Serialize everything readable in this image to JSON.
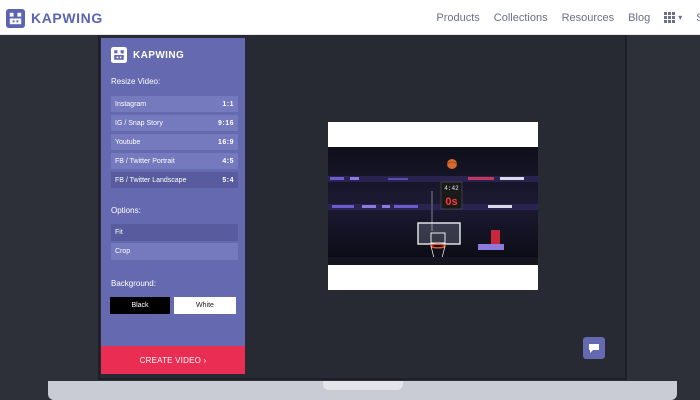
{
  "brand": {
    "name": "KAPWING"
  },
  "nav": {
    "links": [
      "Products",
      "Collections",
      "Resources",
      "Blog"
    ],
    "cutoff": "Si"
  },
  "editor": {
    "brand": "KAPWING",
    "resize_heading": "Resize Video:",
    "sizes": [
      {
        "label": "Instagram",
        "ratio": "1:1"
      },
      {
        "label": "IG / Snap Story",
        "ratio": "9:16"
      },
      {
        "label": "Youtube",
        "ratio": "16:9"
      },
      {
        "label": "FB / Twitter Portrait",
        "ratio": "4:5"
      },
      {
        "label": "FB / Twitter Landscape",
        "ratio": "5:4"
      }
    ],
    "options_heading": "Options:",
    "options": [
      "Fit",
      "Crop"
    ],
    "background_heading": "Background:",
    "background": {
      "black": "Black",
      "white": "White"
    },
    "create_label": "CREATE VIDEO ›"
  },
  "video": {
    "scoreboard": "0s",
    "shot_clock": "4:42"
  },
  "colors": {
    "brand": "#5b64b4",
    "sidebar": "#6569b0",
    "create": "#ea2d52",
    "background": "#2d3039"
  },
  "icons": {
    "logo": "kapwing-logo-icon",
    "apps": "apps-grid-icon",
    "chat": "chat-icon"
  }
}
